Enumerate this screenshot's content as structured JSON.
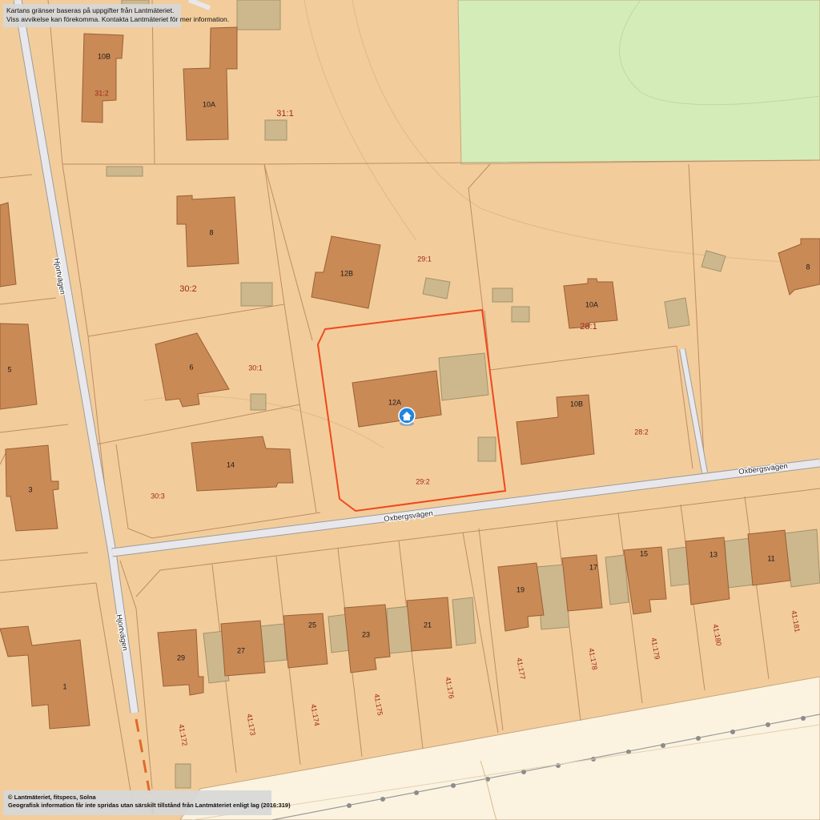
{
  "notice": {
    "line1": "Kartans gränser baseras på uppgifter från Lantmäteriet.",
    "line2": "Viss avvikelse kan förekomma. Kontakta Lantmäteriet för mer information."
  },
  "copyright": {
    "line1": "© Lantmäteriet, fitspecs, Solna",
    "line2": "Geografisk information får inte spridas utan särskilt tillstånd från Lantmäteriet enligt lag (2016:319)"
  },
  "streets": {
    "hjortvagen_upper": "Hjortvägen",
    "hjortvagen_lower": "Hjortvägen",
    "oxbergsvagen_left": "Oxbergsvägen",
    "oxbergsvagen_right": "Oxbergsvägen"
  },
  "houses": {
    "h10b_top": "10B",
    "h10a_top": "10A",
    "h8_left": "8",
    "h12b": "12B",
    "h6": "6",
    "h5": "5",
    "h14": "14",
    "h3": "3",
    "h12a": "12A",
    "h10a_right": "10A",
    "h10b_right": "10B",
    "h8_right": "8",
    "h1": "1",
    "h29": "29",
    "h27": "27",
    "h25": "25",
    "h23": "23",
    "h21": "21",
    "h19": "19",
    "h17": "17",
    "h15": "15",
    "h13": "13",
    "h11": "11"
  },
  "parcels": {
    "p31_2": "31:2",
    "p31_1": "31:1",
    "p29_1": "29:1",
    "p30_2": "30:2",
    "p30_1": "30:1",
    "p30_3": "30:3",
    "p29_2": "29:2",
    "p28_1": "28:1",
    "p28_2": "28:2",
    "p41_172": "41:172",
    "p41_173": "41:173",
    "p41_174": "41:174",
    "p41_175": "41:175",
    "p41_176": "41:176",
    "p41_177": "41:177",
    "p41_178": "41:178",
    "p41_179": "41:179",
    "p41_180": "41:180",
    "p41_181": "41:181"
  },
  "colors": {
    "land": "#f2cd9b",
    "park": "#d4edb8",
    "building": "#c98a56",
    "outbuilding": "#cdb88e",
    "selected_parcel": "#f0481f",
    "parcel_label": "#a0261e",
    "road": "#e8e8ec",
    "rail_area": "#fbf3e0"
  },
  "icons": {
    "selected_marker": "home-location-icon"
  }
}
